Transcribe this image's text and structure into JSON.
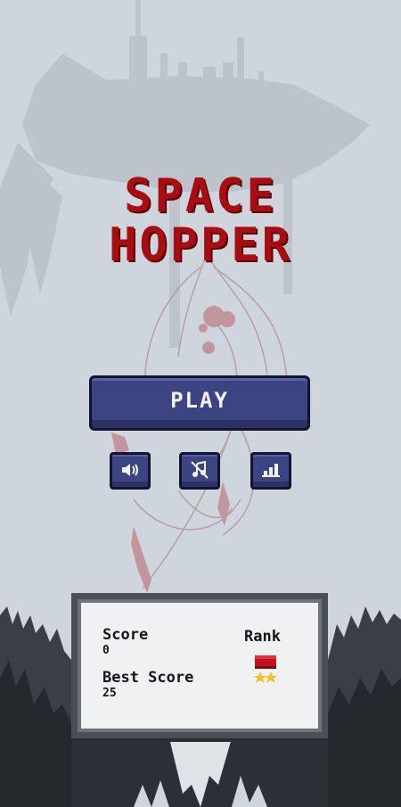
{
  "game": {
    "title_line1": "SPACE",
    "title_line2": "HOPPER"
  },
  "menu": {
    "play_label": "PLAY",
    "sound_icon": "speaker-icon",
    "music_icon": "music-muted-icon",
    "leaderboard_icon": "bar-chart-icon"
  },
  "score_panel": {
    "score_label": "Score",
    "score_value": "0",
    "best_label": "Best Score",
    "best_value": "25",
    "rank_label": "Rank",
    "rank_icon": "medal-icon"
  },
  "colors": {
    "title": "#a80d12",
    "button": "#3d4482",
    "button_border": "#121430",
    "panel_border": "#4a4f57",
    "background": "#cfd5dc"
  }
}
